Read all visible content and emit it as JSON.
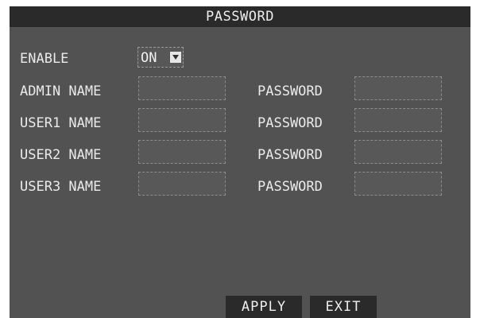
{
  "window": {
    "title": "PASSWORD"
  },
  "enable": {
    "label": "ENABLE",
    "value": "ON"
  },
  "rows": [
    {
      "name_label": "ADMIN NAME",
      "name_value": "",
      "password_label": "PASSWORD",
      "password_value": ""
    },
    {
      "name_label": "USER1 NAME",
      "name_value": "",
      "password_label": "PASSWORD",
      "password_value": ""
    },
    {
      "name_label": "USER2 NAME",
      "name_value": "",
      "password_label": "PASSWORD",
      "password_value": ""
    },
    {
      "name_label": "USER3 NAME",
      "name_value": "",
      "password_label": "PASSWORD",
      "password_value": ""
    }
  ],
  "buttons": {
    "apply": "APPLY",
    "exit": "EXIT"
  },
  "icons": {
    "dropdown": "chevron-down-icon"
  }
}
